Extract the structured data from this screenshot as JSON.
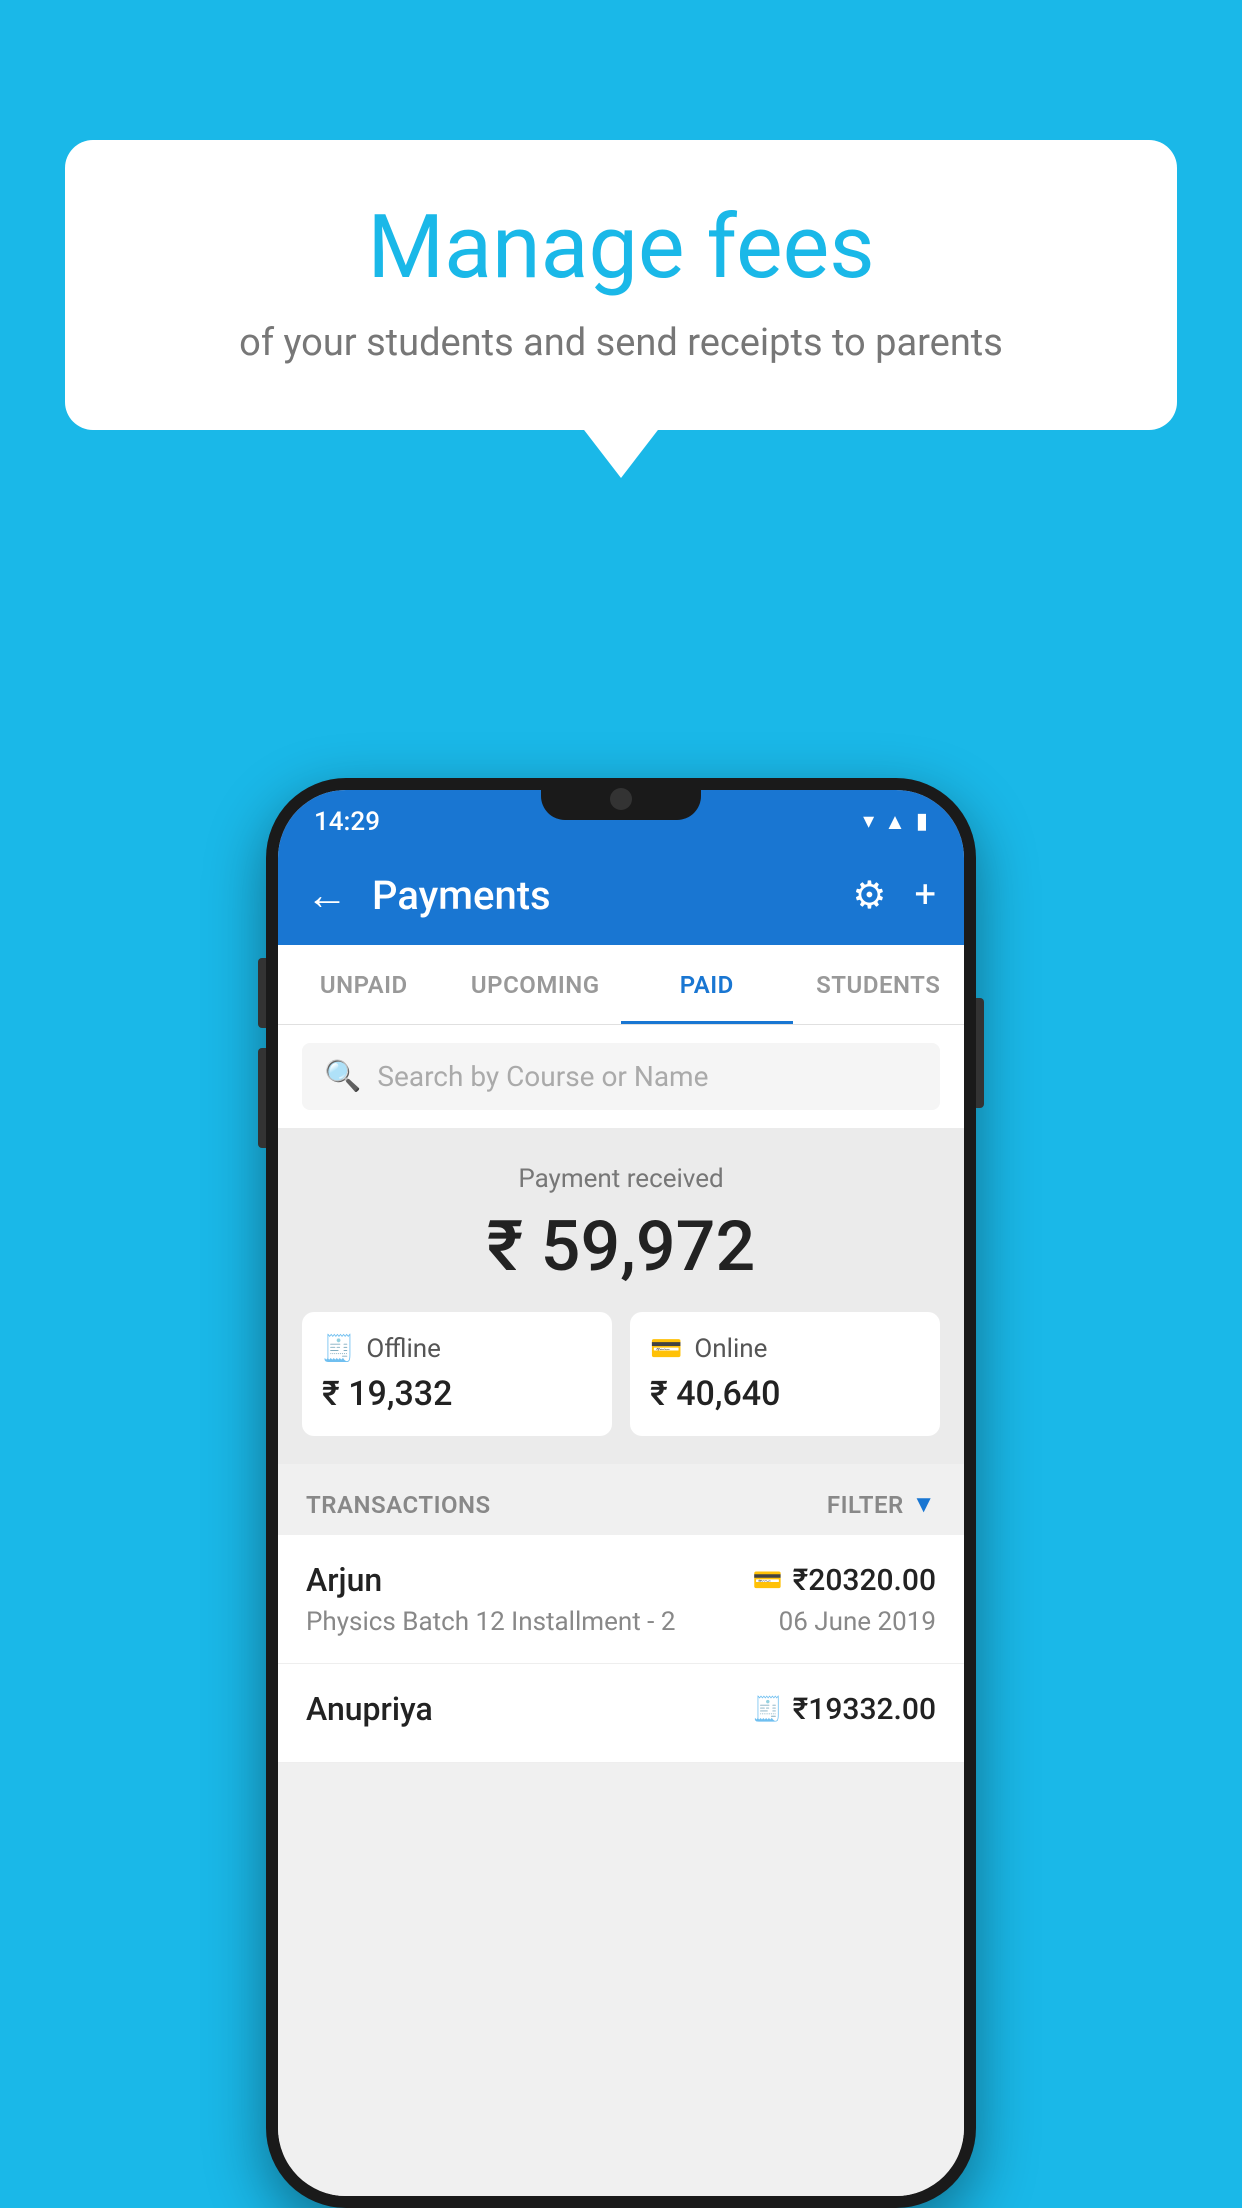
{
  "background_color": "#1ab8e8",
  "speech_bubble": {
    "title": "Manage fees",
    "subtitle": "of your students and send receipts to parents"
  },
  "status_bar": {
    "time": "14:29",
    "icons": [
      "wifi",
      "signal",
      "battery"
    ]
  },
  "app_bar": {
    "title": "Payments",
    "back_label": "←",
    "gear_label": "⚙",
    "plus_label": "+"
  },
  "tabs": [
    {
      "label": "UNPAID",
      "active": false
    },
    {
      "label": "UPCOMING",
      "active": false
    },
    {
      "label": "PAID",
      "active": true
    },
    {
      "label": "STUDENTS",
      "active": false
    }
  ],
  "search": {
    "placeholder": "Search by Course or Name"
  },
  "payment_received": {
    "label": "Payment received",
    "amount": "₹ 59,972",
    "offline": {
      "label": "Offline",
      "amount": "₹ 19,332"
    },
    "online": {
      "label": "Online",
      "amount": "₹ 40,640"
    }
  },
  "transactions": {
    "section_label": "TRANSACTIONS",
    "filter_label": "FILTER",
    "rows": [
      {
        "name": "Arjun",
        "amount": "₹20320.00",
        "type_icon": "card",
        "course": "Physics Batch 12 Installment - 2",
        "date": "06 June 2019"
      },
      {
        "name": "Anupriya",
        "amount": "₹19332.00",
        "type_icon": "cash",
        "course": "",
        "date": ""
      }
    ]
  }
}
